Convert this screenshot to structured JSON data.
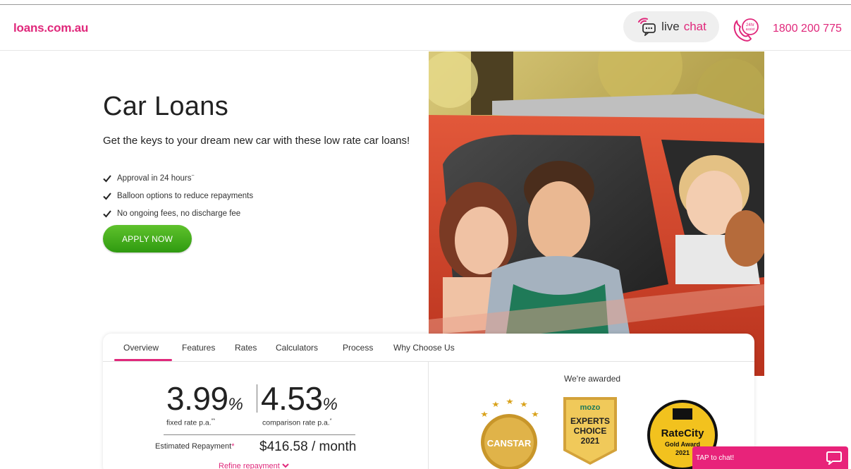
{
  "header": {
    "logo": "loans.com.au",
    "chat_live": "live",
    "chat_chat": "chat",
    "phone_badge": "24hr assist",
    "phone": "1800 200 775"
  },
  "hero": {
    "title": "Car Loans",
    "subtitle": "Get the keys to your dream new car with these low rate car loans!",
    "features": [
      {
        "text": "Approval in 24 hours",
        "mark": "~"
      },
      {
        "text": "Balloon options to reduce repayments",
        "mark": ""
      },
      {
        "text": "No ongoing fees, no discharge fee",
        "mark": ""
      }
    ],
    "apply_label": "APPLY NOW"
  },
  "tabs": [
    "Overview",
    "Features",
    "Rates",
    "Calculators",
    "Process",
    "Why Choose Us"
  ],
  "rates": {
    "fixed_value": "3.99",
    "fixed_caption": "fixed rate p.a.",
    "fixed_mark": "**",
    "comparison_value": "4.53",
    "comparison_caption": "comparison rate p.a.",
    "comparison_mark": "*",
    "percent": "%",
    "estimated_label": "Estimated Repayment",
    "estimated_mark": "*",
    "estimated_value": "$416.58 / month",
    "refine_label": "Refine repayment"
  },
  "awards": {
    "heading": "We're awarded",
    "canstar": "CANSTAR",
    "mozo_brand": "mozo",
    "mozo_line1": "EXPERTS",
    "mozo_line2": "CHOICE",
    "mozo_year": "2021",
    "ratecity_brand": "RateCity",
    "ratecity_line": "Gold Award",
    "ratecity_year": "2021"
  },
  "chat_widget": {
    "label": "TAP to chat!"
  },
  "colors": {
    "brand_pink": "#e0287b",
    "cta_green": "#3aa617"
  }
}
